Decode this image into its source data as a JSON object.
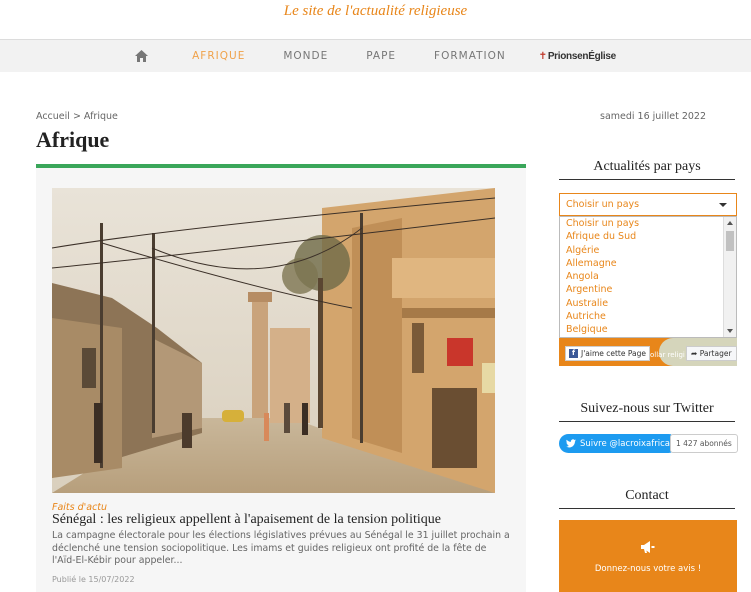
{
  "header": {
    "tagline": "Le site de l'actualité religieuse"
  },
  "nav": {
    "home_icon": "home-icon",
    "items": [
      {
        "label": "AFRIQUE",
        "active": true
      },
      {
        "label": "MONDE",
        "active": false
      },
      {
        "label": "PAPE",
        "active": false
      },
      {
        "label": "FORMATION",
        "active": false
      }
    ],
    "prions": {
      "cross": "✝",
      "label": "PrionsenÉglise"
    }
  },
  "breadcrumb": "Accueil > Afrique",
  "date": "samedi 16 juillet 2022",
  "page_title": "Afrique",
  "article": {
    "category": "Faits d'actu",
    "title": "Sénégal : les religieux appellent à l'apaisement de la tension politique",
    "excerpt": "La campagne électorale pour les élections législatives prévues au Sénégal le 31 juillet prochain a déclenché une tension sociopolitique. Les imams et guides religieux ont profité de la fête de l'Aïd-El-Kébir pour appeler...",
    "published": "Publié le 15/07/2022"
  },
  "sidebar": {
    "countries": {
      "title": "Actualités par pays",
      "selected": "Choisir un pays",
      "options": [
        "Choisir un pays",
        "Afrique du Sud",
        "Algérie",
        "Allemagne",
        "Angola",
        "Argentine",
        "Australie",
        "Autriche",
        "Belgique"
      ]
    },
    "facebook": {
      "like": "J'aime cette Page",
      "partial": "ollar religi",
      "share": "Partager"
    },
    "twitter": {
      "title": "Suivez-nous sur Twitter",
      "follow": "Suivre @lacroixafrica",
      "count": "1 427 abonnés"
    },
    "contact": {
      "title": "Contact",
      "text": "Donnez-nous votre avis !"
    }
  },
  "colors": {
    "accent": "#e8861a",
    "green": "#3aa65a",
    "twitter": "#1d9bf0",
    "facebook": "#3b5998"
  }
}
